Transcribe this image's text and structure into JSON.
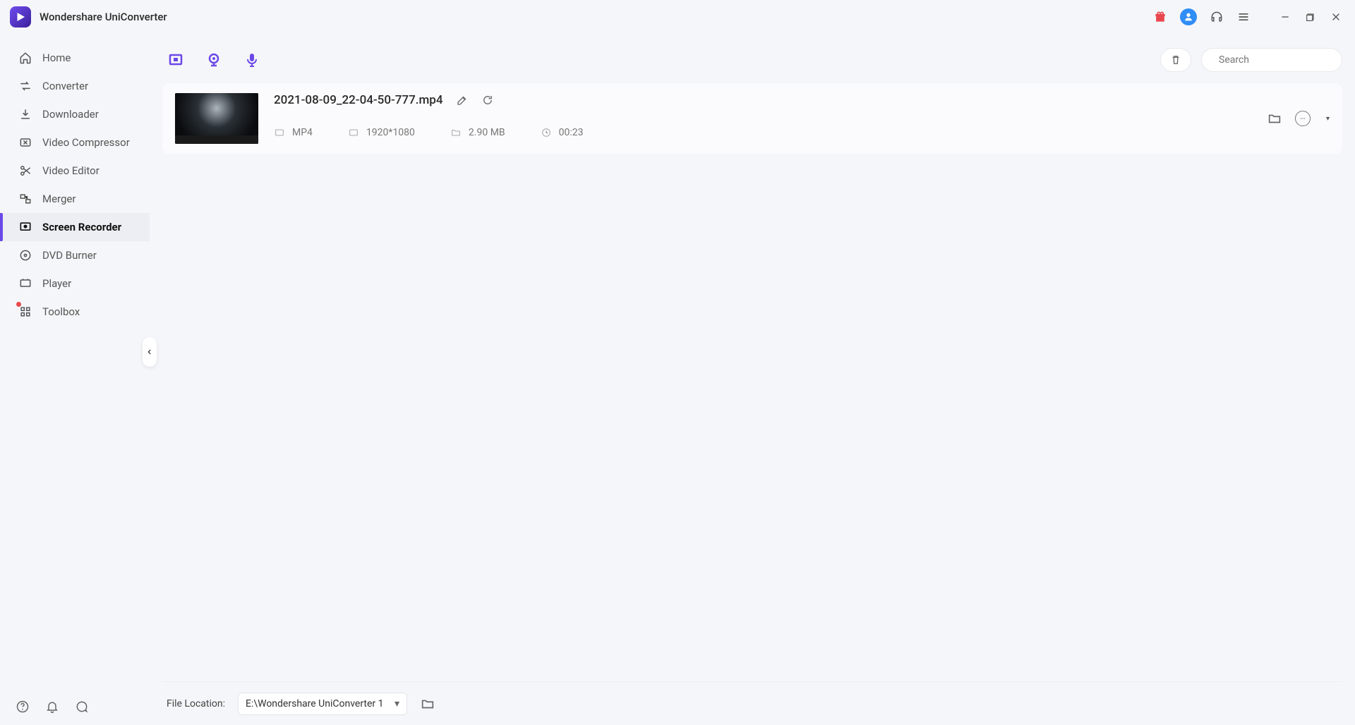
{
  "app_title": "Wondershare UniConverter",
  "sidebar": {
    "items": [
      {
        "label": "Home"
      },
      {
        "label": "Converter"
      },
      {
        "label": "Downloader"
      },
      {
        "label": "Video Compressor"
      },
      {
        "label": "Video Editor"
      },
      {
        "label": "Merger"
      },
      {
        "label": "Screen Recorder"
      },
      {
        "label": "DVD Burner"
      },
      {
        "label": "Player"
      },
      {
        "label": "Toolbox"
      }
    ],
    "active_index": 6
  },
  "toolbar": {
    "search_placeholder": "Search"
  },
  "files": [
    {
      "name": "2021-08-09_22-04-50-777.mp4",
      "format": "MP4",
      "resolution": "1920*1080",
      "size": "2.90 MB",
      "duration": "00:23"
    }
  ],
  "footer": {
    "label": "File Location:",
    "path": "E:\\Wondershare UniConverter 1"
  }
}
